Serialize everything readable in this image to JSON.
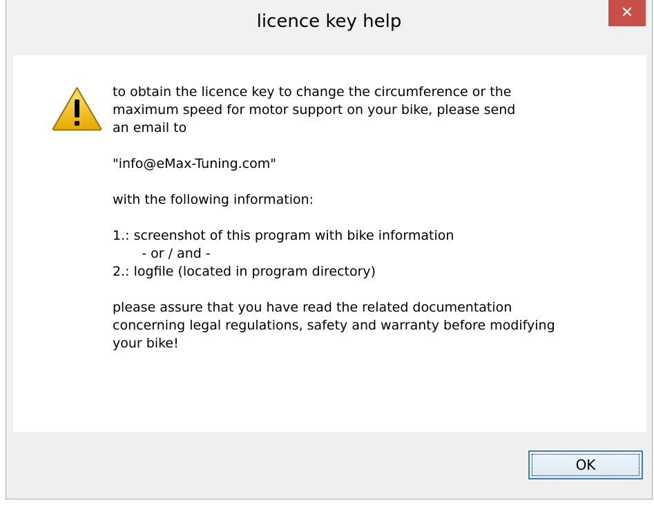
{
  "window": {
    "title": "licence key help",
    "close_glyph": "✕"
  },
  "icon": {
    "name": "warning-icon",
    "color": "#f4c515"
  },
  "message": {
    "lines": [
      "to obtain the licence key to change the circumference or the",
      "maximum speed for motor support on your bike, please send",
      "an email to",
      "",
      "\"info@eMax-Tuning.com\"",
      "",
      "with the following information:",
      "",
      "1.: screenshot of this program with bike information",
      "       - or / and -",
      "2.: logfile (located in program directory)",
      "",
      "please assure that you have read the related documentation",
      "concerning legal regulations, safety and warranty before modifying",
      "your bike!"
    ]
  },
  "buttons": {
    "ok_label": "OK"
  }
}
